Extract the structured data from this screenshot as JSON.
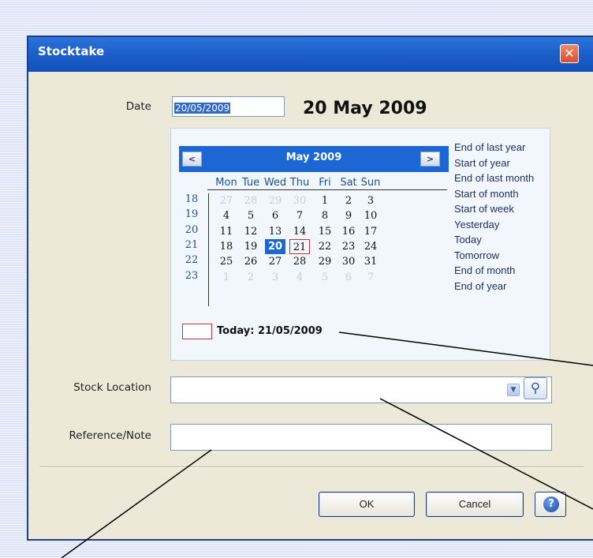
{
  "window": {
    "title": "Stocktake",
    "close_glyph": "✕"
  },
  "date": {
    "label": "Date",
    "value": "20/05/2009",
    "long_display": "20 May 2009"
  },
  "calendar": {
    "month_title": "May 2009",
    "prev_glyph": "<",
    "next_glyph": ">",
    "days_of_week": [
      "Mon",
      "Tue",
      "Wed",
      "Thu",
      "Fri",
      "Sat",
      "Sun"
    ],
    "weeks": [
      {
        "num": "18",
        "days": [
          [
            "27",
            1
          ],
          [
            "28",
            1
          ],
          [
            "29",
            1
          ],
          [
            "30",
            1
          ],
          [
            "1",
            0
          ],
          [
            "2",
            0
          ],
          [
            "3",
            0
          ]
        ]
      },
      {
        "num": "19",
        "days": [
          [
            "4",
            0
          ],
          [
            "5",
            0
          ],
          [
            "6",
            0
          ],
          [
            "7",
            0
          ],
          [
            "8",
            0
          ],
          [
            "9",
            0
          ],
          [
            "10",
            0
          ]
        ]
      },
      {
        "num": "20",
        "days": [
          [
            "11",
            0
          ],
          [
            "12",
            0
          ],
          [
            "13",
            0
          ],
          [
            "14",
            0
          ],
          [
            "15",
            0
          ],
          [
            "16",
            0
          ],
          [
            "17",
            0
          ]
        ]
      },
      {
        "num": "21",
        "days": [
          [
            "18",
            0
          ],
          [
            "19",
            0
          ],
          [
            "20",
            0
          ],
          [
            "21",
            0
          ],
          [
            "22",
            0
          ],
          [
            "23",
            0
          ],
          [
            "24",
            0
          ]
        ]
      },
      {
        "num": "22",
        "days": [
          [
            "25",
            0
          ],
          [
            "26",
            0
          ],
          [
            "27",
            0
          ],
          [
            "28",
            0
          ],
          [
            "29",
            0
          ],
          [
            "30",
            0
          ],
          [
            "31",
            0
          ]
        ]
      },
      {
        "num": "23",
        "days": [
          [
            "1",
            1
          ],
          [
            "2",
            1
          ],
          [
            "3",
            1
          ],
          [
            "4",
            1
          ],
          [
            "5",
            1
          ],
          [
            "6",
            1
          ],
          [
            "7",
            1
          ]
        ]
      }
    ],
    "selected_day": "20",
    "today_day": "21",
    "today_label": "Today: 21/05/2009",
    "shortcuts": [
      "End of last year",
      "Start of year",
      "End of last month",
      "Start of month",
      "Start of week",
      "Yesterday",
      "Today",
      "Tomorrow",
      "End of month",
      "End of year"
    ],
    "colors": {
      "header": "#1c67d4",
      "selected": "#1c67d4",
      "today_border": "#c43434"
    }
  },
  "stock_location": {
    "label": "Stock Location",
    "value": "",
    "dropdown_icon": "chevron-down-icon",
    "search_icon": "magnifier-icon"
  },
  "reference": {
    "label": "Reference/Note",
    "value": ""
  },
  "buttons": {
    "ok": "OK",
    "cancel": "Cancel",
    "help_glyph": "?"
  }
}
